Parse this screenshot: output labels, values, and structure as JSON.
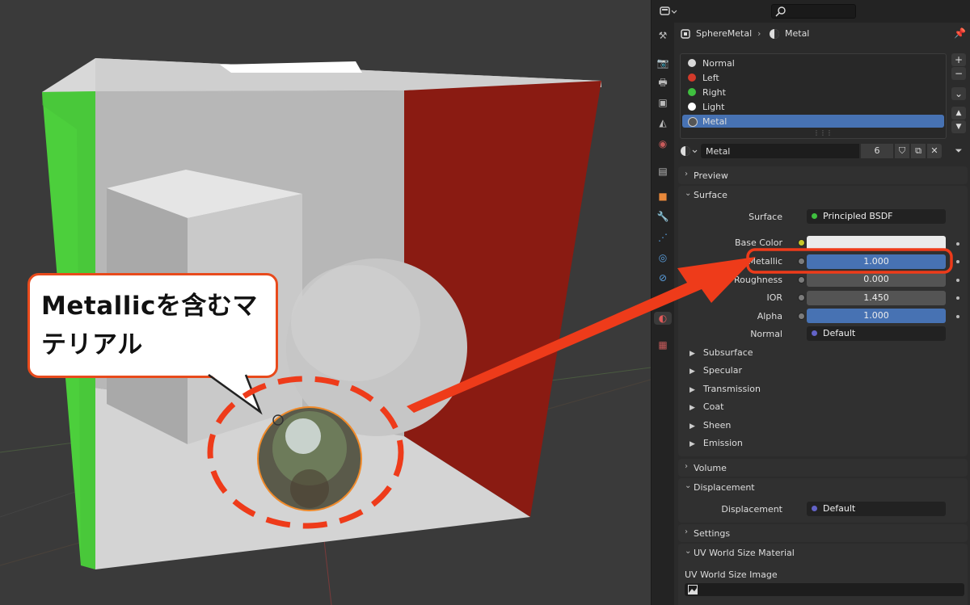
{
  "callout": {
    "line1": "Metallicを含むマ",
    "line2": "テリアル"
  },
  "header": {
    "editor_type_icon": "properties-editor-icon",
    "search_icon": "search-icon"
  },
  "breadcrumb": {
    "object": "SphereMetal",
    "separator": "›",
    "material": "Metal"
  },
  "material_slots": [
    {
      "name": "Normal",
      "color": "#d8d8d8"
    },
    {
      "name": "Left",
      "color": "#d23a2a"
    },
    {
      "name": "Right",
      "color": "#3fbf3f"
    },
    {
      "name": "Light",
      "color": "#ffffff"
    },
    {
      "name": "Metal",
      "color": "#555555",
      "selected": true
    }
  ],
  "slot_buttons": {
    "add": "+",
    "remove": "−",
    "menu": "⌄",
    "up": "▲",
    "down": "▼"
  },
  "material_selector": {
    "name": "Metal",
    "users": "6"
  },
  "sections": {
    "preview": "Preview",
    "surface": "Surface",
    "volume": "Volume",
    "displacement": "Displacement",
    "settings": "Settings",
    "uv_world": "UV World Size Material"
  },
  "surface": {
    "surface_label": "Surface",
    "surface_value": "Principled BSDF",
    "properties": [
      {
        "label": "Base Color",
        "value": "",
        "socket_color": "#c7c729"
      },
      {
        "label": "Metallic",
        "value": "1.000",
        "socket_color": "#a1a1a1",
        "fill": 1.0
      },
      {
        "label": "Roughness",
        "value": "0.000",
        "socket_color": "#a1a1a1",
        "fill": 0.0
      },
      {
        "label": "IOR",
        "value": "1.450",
        "socket_color": "#a1a1a1",
        "fill": 0.0
      },
      {
        "label": "Alpha",
        "value": "1.000",
        "socket_color": "#a1a1a1",
        "fill": 1.0
      },
      {
        "label": "Normal",
        "value": "Default",
        "socket_color": "#6363c7"
      }
    ],
    "subpanels": [
      "Subsurface",
      "Specular",
      "Transmission",
      "Coat",
      "Sheen",
      "Emission"
    ]
  },
  "displacement": {
    "label": "Displacement",
    "value": "Default"
  },
  "uv_world": {
    "image_label": "UV World Size Image"
  }
}
